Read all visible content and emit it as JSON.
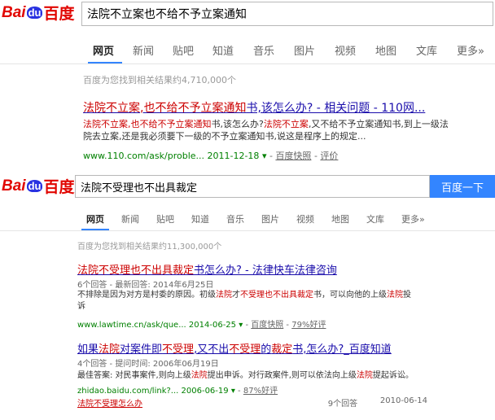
{
  "top": {
    "logo": {
      "bai": "Bai",
      "du": "du",
      "text": "百度"
    },
    "query": "法院不立案也不给不予立案通知",
    "tabs": [
      "网页",
      "新闻",
      "贴吧",
      "知道",
      "音乐",
      "图片",
      "视频",
      "地图",
      "文库",
      "更多»"
    ],
    "result_count": "百度为您找到相关结果约4,710,000个",
    "result": {
      "title_red": "法院不立案",
      "title_mid1": ",也不给",
      "title_red2": "不予立案通知",
      "title_rest": "书,该怎么办? - 相关问题 - 110网...",
      "snippet1_red": "法院不立案,也不给不予立案通知",
      "snippet1_rest": "书,该怎么办?",
      "snippet1_red2": "法院不立案",
      "snippet1_rest2": ",又不给不予立案通知书,到上一级法",
      "snippet2": "院去立案,还是我必须要下一级的不予立案通知书,说这是程序上的规定...",
      "url": "www.110.com/ask/proble... 2011-12-18",
      "arrow": "▾",
      "snapshot": "百度快照",
      "rating": "评价"
    }
  },
  "bottom": {
    "logo": {
      "bai": "Bai",
      "du": "du",
      "text": "百度"
    },
    "query": "法院不受理也不出具裁定",
    "search_button": "百度一下",
    "tabs": [
      "网页",
      "新闻",
      "贴吧",
      "知道",
      "音乐",
      "图片",
      "视频",
      "地图",
      "文库",
      "更多»"
    ],
    "result_count": "百度为您找到相关结果约11,300,000个",
    "result1": {
      "title_red": "法院不受理也不出具裁定",
      "title_rest": "书怎么办? - 法律快车法律咨询",
      "meta": "6个回答 - 最新回答: 2014年6月25日",
      "snip_a": "不排除是因为对方是村委的原因。初级",
      "snip_red1": "法院",
      "snip_b": "才",
      "snip_red2": "不受理也不出具裁定",
      "snip_c": "书，可以向他的上级",
      "snip_red3": "法院",
      "snip_d": "投",
      "snip_line2": "诉",
      "url": "www.lawtime.cn/ask/que... 2014-06-25",
      "arrow": "▾",
      "snapshot": "百度快照",
      "rating": "79%好评"
    },
    "result2": {
      "title_a": "如果",
      "title_red1": "法院",
      "title_b": "对案件即",
      "title_red2": "不受理",
      "title_c": ",又不出",
      "title_red3": "不受理",
      "title_d": "的",
      "title_red4": "裁定",
      "title_e": "书,怎么办?_百度知道",
      "meta": "4个回答 - 提问时间: 2006年06月19日",
      "snip_a": "最佳答案: 对民事案件,则向上级",
      "snip_red1": "法院",
      "snip_b": "提出申诉。对行政案件,则可以依法向上级",
      "snip_red2": "法院",
      "snip_c": "提起诉讼。",
      "url": "zhidao.baidu.com/link?... 2006-06-19",
      "arrow": "▾",
      "rating": "87%好评",
      "related_link": "法院不受理怎么办",
      "related_count": "9个回答",
      "related_date": "2010-06-14"
    }
  }
}
